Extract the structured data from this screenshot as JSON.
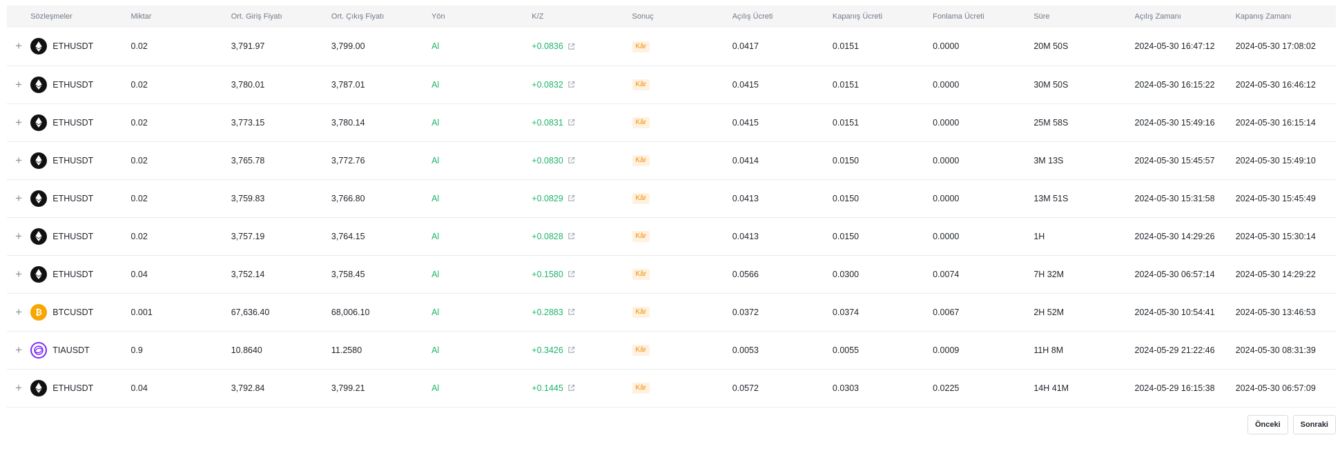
{
  "headers": [
    "Sözleşmeler",
    "Miktar",
    "Ort. Giriş Fiyatı",
    "Ort. Çıkış Fiyatı",
    "Yön",
    "K/Z",
    "Sonuç",
    "Açılış Ücreti",
    "Kapanış Ücreti",
    "Fonlama Ücreti",
    "Süre",
    "Açılış Zamanı",
    "Kapanış Zamanı"
  ],
  "expand_symbol": "+",
  "colors": {
    "profit_green": "#20b26c",
    "badge_bg": "#fff1e0",
    "badge_text": "#f08d00",
    "eth_icon_bg": "#111111",
    "btc_icon_bg": "#f7a600",
    "tia_icon_color": "#7b2bf9"
  },
  "rows": [
    {
      "symbol": "ETHUSDT",
      "icon": "ethereum-icon",
      "coin": "eth",
      "qty": "0.02",
      "entry": "3,791.97",
      "exit": "3,799.00",
      "side": "Al",
      "pnl": "+0.0836",
      "result": "Kâr",
      "open_fee": "0.0417",
      "close_fee": "0.0151",
      "funding_fee": "0.0000",
      "duration": "20M 50S",
      "open_time": "2024-05-30 16:47:12",
      "close_time": "2024-05-30 17:08:02"
    },
    {
      "symbol": "ETHUSDT",
      "icon": "ethereum-icon",
      "coin": "eth",
      "qty": "0.02",
      "entry": "3,780.01",
      "exit": "3,787.01",
      "side": "Al",
      "pnl": "+0.0832",
      "result": "Kâr",
      "open_fee": "0.0415",
      "close_fee": "0.0151",
      "funding_fee": "0.0000",
      "duration": "30M 50S",
      "open_time": "2024-05-30 16:15:22",
      "close_time": "2024-05-30 16:46:12"
    },
    {
      "symbol": "ETHUSDT",
      "icon": "ethereum-icon",
      "coin": "eth",
      "qty": "0.02",
      "entry": "3,773.15",
      "exit": "3,780.14",
      "side": "Al",
      "pnl": "+0.0831",
      "result": "Kâr",
      "open_fee": "0.0415",
      "close_fee": "0.0151",
      "funding_fee": "0.0000",
      "duration": "25M 58S",
      "open_time": "2024-05-30 15:49:16",
      "close_time": "2024-05-30 16:15:14"
    },
    {
      "symbol": "ETHUSDT",
      "icon": "ethereum-icon",
      "coin": "eth",
      "qty": "0.02",
      "entry": "3,765.78",
      "exit": "3,772.76",
      "side": "Al",
      "pnl": "+0.0830",
      "result": "Kâr",
      "open_fee": "0.0414",
      "close_fee": "0.0150",
      "funding_fee": "0.0000",
      "duration": "3M 13S",
      "open_time": "2024-05-30 15:45:57",
      "close_time": "2024-05-30 15:49:10"
    },
    {
      "symbol": "ETHUSDT",
      "icon": "ethereum-icon",
      "coin": "eth",
      "qty": "0.02",
      "entry": "3,759.83",
      "exit": "3,766.80",
      "side": "Al",
      "pnl": "+0.0829",
      "result": "Kâr",
      "open_fee": "0.0413",
      "close_fee": "0.0150",
      "funding_fee": "0.0000",
      "duration": "13M 51S",
      "open_time": "2024-05-30 15:31:58",
      "close_time": "2024-05-30 15:45:49"
    },
    {
      "symbol": "ETHUSDT",
      "icon": "ethereum-icon",
      "coin": "eth",
      "qty": "0.02",
      "entry": "3,757.19",
      "exit": "3,764.15",
      "side": "Al",
      "pnl": "+0.0828",
      "result": "Kâr",
      "open_fee": "0.0413",
      "close_fee": "0.0150",
      "funding_fee": "0.0000",
      "duration": "1H",
      "open_time": "2024-05-30 14:29:26",
      "close_time": "2024-05-30 15:30:14"
    },
    {
      "symbol": "ETHUSDT",
      "icon": "ethereum-icon",
      "coin": "eth",
      "qty": "0.04",
      "entry": "3,752.14",
      "exit": "3,758.45",
      "side": "Al",
      "pnl": "+0.1580",
      "result": "Kâr",
      "open_fee": "0.0566",
      "close_fee": "0.0300",
      "funding_fee": "0.0074",
      "duration": "7H 32M",
      "open_time": "2024-05-30 06:57:14",
      "close_time": "2024-05-30 14:29:22"
    },
    {
      "symbol": "BTCUSDT",
      "icon": "bitcoin-icon",
      "coin": "btc",
      "qty": "0.001",
      "entry": "67,636.40",
      "exit": "68,006.10",
      "side": "Al",
      "pnl": "+0.2883",
      "result": "Kâr",
      "open_fee": "0.0372",
      "close_fee": "0.0374",
      "funding_fee": "0.0067",
      "duration": "2H 52M",
      "open_time": "2024-05-30 10:54:41",
      "close_time": "2024-05-30 13:46:53"
    },
    {
      "symbol": "TIAUSDT",
      "icon": "celestia-icon",
      "coin": "tia",
      "qty": "0.9",
      "entry": "10.8640",
      "exit": "11.2580",
      "side": "Al",
      "pnl": "+0.3426",
      "result": "Kâr",
      "open_fee": "0.0053",
      "close_fee": "0.0055",
      "funding_fee": "0.0009",
      "duration": "11H 8M",
      "open_time": "2024-05-29 21:22:46",
      "close_time": "2024-05-30 08:31:39"
    },
    {
      "symbol": "ETHUSDT",
      "icon": "ethereum-icon",
      "coin": "eth",
      "qty": "0.04",
      "entry": "3,792.84",
      "exit": "3,799.21",
      "side": "Al",
      "pnl": "+0.1445",
      "result": "Kâr",
      "open_fee": "0.0572",
      "close_fee": "0.0303",
      "funding_fee": "0.0225",
      "duration": "14H 41M",
      "open_time": "2024-05-29 16:15:38",
      "close_time": "2024-05-30 06:57:09"
    }
  ],
  "pagination": {
    "prev_label": "Önceki",
    "next_label": "Sonraki"
  }
}
